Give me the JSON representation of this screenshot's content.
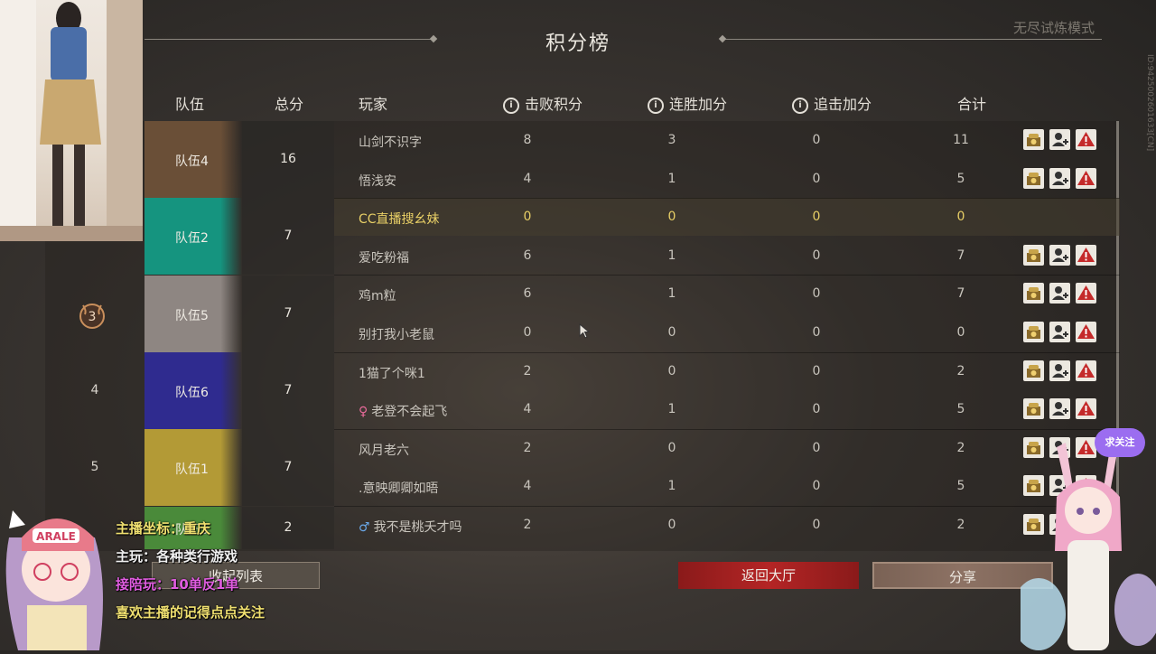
{
  "header": {
    "title": "积分榜",
    "mode": "无尽试炼模式",
    "id_text": "ID:9425002601633[CN]"
  },
  "columns": {
    "team": "队伍",
    "total": "总分",
    "player": "玩家",
    "defeat": "击败积分",
    "streak": "连胜加分",
    "chase": "追击加分",
    "sum": "合计",
    "info_glyph": "i"
  },
  "teams": [
    {
      "rank": "",
      "name": "队伍4",
      "score": "16",
      "color": "#6a4f37"
    },
    {
      "rank": "",
      "name": "队伍2",
      "score": "7",
      "color": "#15947f"
    },
    {
      "rank": "3",
      "name": "队伍5",
      "score": "7",
      "color": "#8e8682"
    },
    {
      "rank": "4",
      "name": "队伍6",
      "score": "7",
      "color": "#2f2b8f"
    },
    {
      "rank": "5",
      "name": "队伍1",
      "score": "7",
      "color": "#b39a36"
    },
    {
      "rank": "",
      "name": "队伍3",
      "score": "2",
      "color": "#4a8a3a"
    }
  ],
  "players": [
    {
      "name": "山剑不识字",
      "defeat": "8",
      "streak": "3",
      "chase": "0",
      "sum": "11",
      "actions": true
    },
    {
      "name": "悟浅安",
      "defeat": "4",
      "streak": "1",
      "chase": "0",
      "sum": "5",
      "actions": true
    },
    {
      "name": "CC直播搜幺妹",
      "defeat": "0",
      "streak": "0",
      "chase": "0",
      "sum": "0",
      "actions": false,
      "self": true
    },
    {
      "name": "爱吃粉福",
      "defeat": "6",
      "streak": "1",
      "chase": "0",
      "sum": "7",
      "actions": true
    },
    {
      "name": "鸡m粒",
      "defeat": "6",
      "streak": "1",
      "chase": "0",
      "sum": "7",
      "actions": true
    },
    {
      "name": "别打我小老鼠",
      "defeat": "0",
      "streak": "0",
      "chase": "0",
      "sum": "0",
      "actions": true
    },
    {
      "name": "1猫了个咪1",
      "defeat": "2",
      "streak": "0",
      "chase": "0",
      "sum": "2",
      "actions": true
    },
    {
      "name": "老登不会起飞",
      "gender": "♀",
      "defeat": "4",
      "streak": "1",
      "chase": "0",
      "sum": "5",
      "actions": true
    },
    {
      "name": "风月老六",
      "defeat": "2",
      "streak": "0",
      "chase": "0",
      "sum": "2",
      "actions": true
    },
    {
      "name": ".意映卿卿如晤",
      "defeat": "4",
      "streak": "1",
      "chase": "0",
      "sum": "5",
      "actions": true
    },
    {
      "name": "我不是桃夭才吗",
      "gender": "♂",
      "defeat": "2",
      "streak": "0",
      "chase": "0",
      "sum": "2",
      "actions": true
    }
  ],
  "buttons": {
    "back": "返回大厅",
    "share": "分享",
    "collapse": "收起列表"
  },
  "overlay": {
    "line1": "主播坐标：重庆",
    "line2": "主玩：各种类行游戏",
    "line3": "接陪玩：10单反1单",
    "line4": "喜欢主播的记得点点关注",
    "bubble": "求关注",
    "cap_text": "ARALE"
  },
  "colors": {
    "accent_red": "#b42525",
    "highlight_yellow": "#e8cf66",
    "line3_color": "#e05ce0"
  }
}
